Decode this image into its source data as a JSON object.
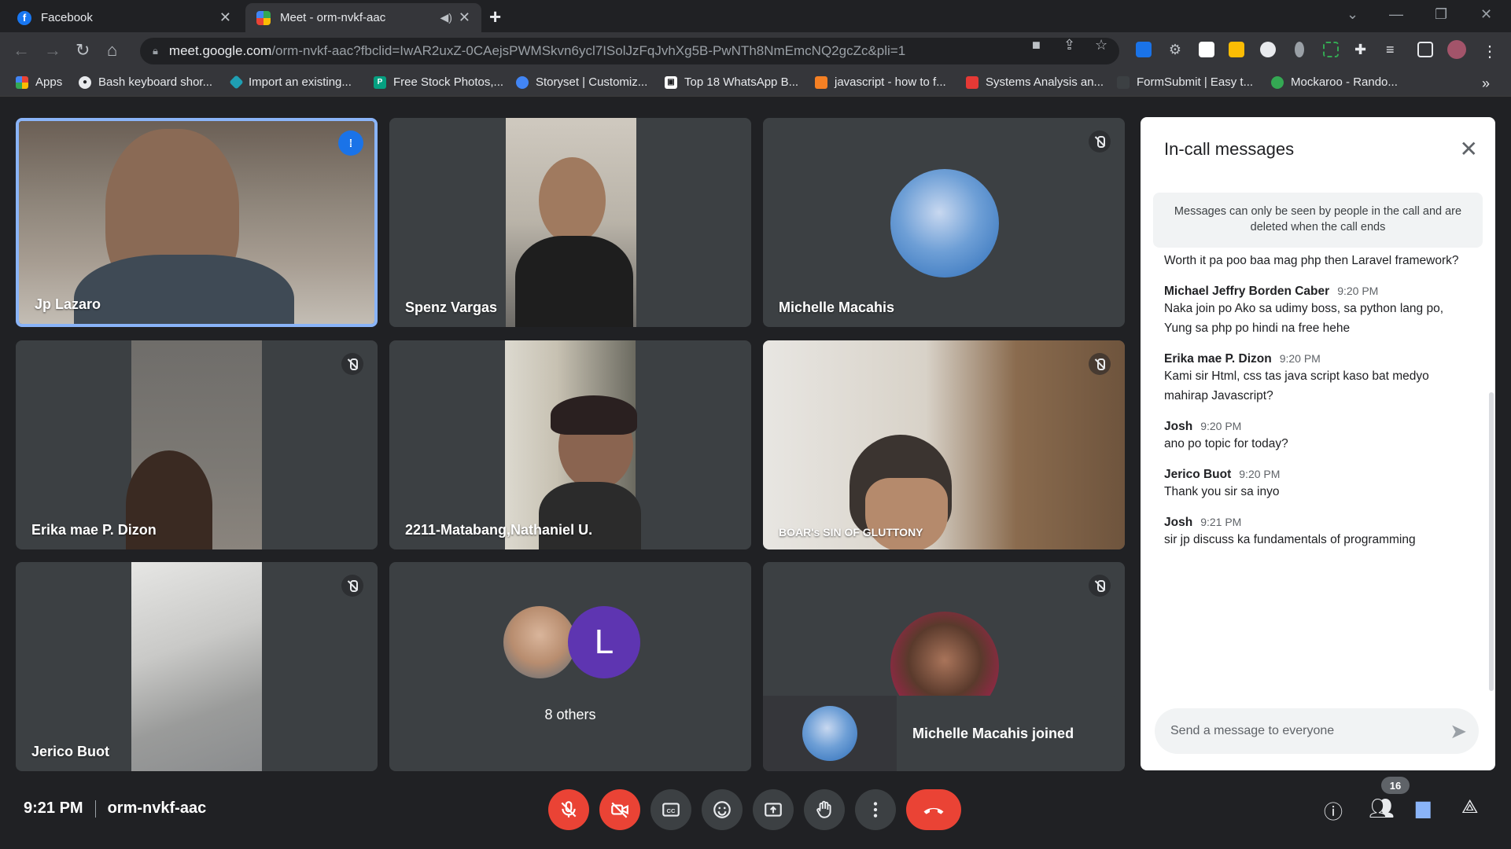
{
  "browser": {
    "tabs": [
      {
        "title": "Facebook",
        "favicon": "facebook-icon",
        "color": "#1877f2"
      },
      {
        "title": "Meet - orm-nvkf-aac",
        "favicon": "google-meet-icon",
        "audio": true
      }
    ],
    "url_host": "meet.google.com",
    "url_path": "/orm-nvkf-aac?fbclid=IwAR2uxZ-0CAejsPWMSkvn6ycl7ISolJzFqJvhXg5B-PwNTh8NmEmcNQ2gcZc&pli=1",
    "bookmarks": [
      "Apps",
      "Bash keyboard shor...",
      "Import an existing...",
      "Free Stock Photos,...",
      "Storyset | Customiz...",
      "Top 18 WhatsApp B...",
      "javascript - how to f...",
      "Systems Analysis an...",
      "FormSubmit | Easy t...",
      "Mockaroo - Rando..."
    ],
    "bookmarks_overflow": "»"
  },
  "meeting": {
    "tiles": [
      {
        "name": "Jp Lazaro",
        "speaking": true
      },
      {
        "name": "Spenz Vargas"
      },
      {
        "name": "Michelle Macahis",
        "muted": true
      },
      {
        "name": "Erika mae P. Dizon",
        "muted": true
      },
      {
        "name": "2211-Matabang,Nathaniel U."
      },
      {
        "name": "BOAR's SIN OF GLUTTONY",
        "muted": true
      },
      {
        "name": "Jerico Buot",
        "muted": true
      },
      {
        "name": "8 others",
        "avatar_letter": "L"
      },
      {
        "name": "",
        "muted": true
      }
    ],
    "join_toast": "Michelle Macahis joined",
    "time": "9:21 PM",
    "code": "orm-nvkf-aac",
    "participant_count": "16"
  },
  "chat": {
    "title": "In-call messages",
    "notice": "Messages can only be seen by people in the call and are deleted when the call ends",
    "first_partial": "Worth it pa poo baa mag php then Laravel framework?",
    "messages": [
      {
        "sender": "Michael Jeffry Borden Caber",
        "time": "9:20 PM",
        "text": "Naka join po Ako sa udimy boss, sa python lang po, Yung sa php po hindi na free hehe"
      },
      {
        "sender": "Erika mae P. Dizon",
        "time": "9:20 PM",
        "text": "Kami sir Html, css tas java script kaso bat medyo mahirap Javascript?"
      },
      {
        "sender": "Josh",
        "time": "9:20 PM",
        "text": "ano po topic for today?"
      },
      {
        "sender": "Jerico Buot",
        "time": "9:20 PM",
        "text": "Thank you sir sa inyo"
      },
      {
        "sender": "Josh",
        "time": "9:21 PM",
        "text": "sir jp discuss ka fundamentals of programming"
      }
    ],
    "input_placeholder": "Send a message to everyone"
  },
  "colors": {
    "meet_red": "#ea4335",
    "speaking_border": "#8ab4f8",
    "accent_blue": "#1a73e8"
  }
}
